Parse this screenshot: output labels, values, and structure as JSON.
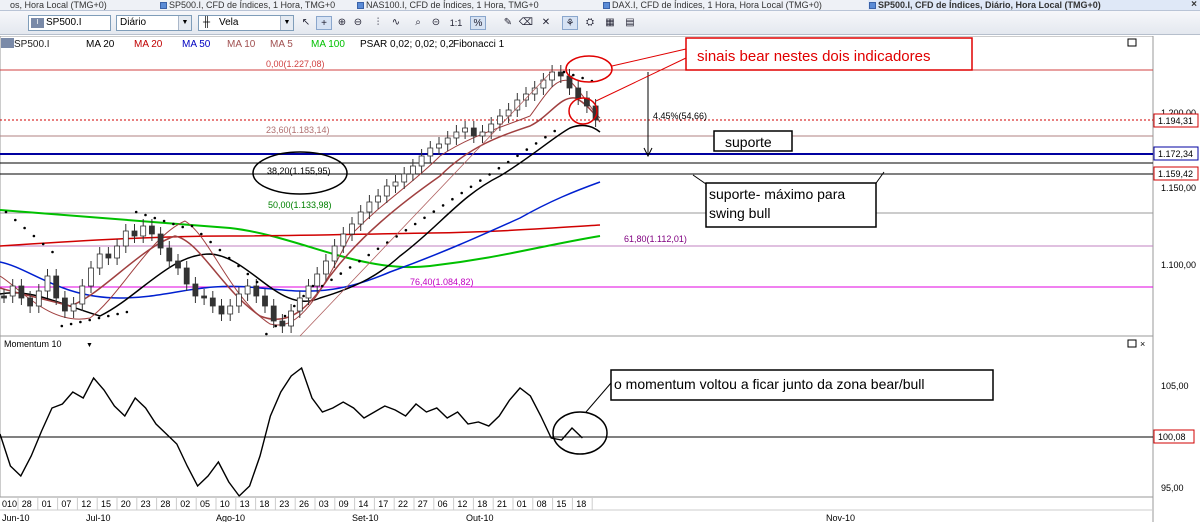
{
  "tabs": [
    {
      "label": "os, Hora Local (TMG+0)",
      "active": false
    },
    {
      "label": "SP500.I, CFD de Índices, 1 Hora, TMG+0",
      "active": false
    },
    {
      "label": "NAS100.I, CFD de Índices, 1 Hora, TMG+0",
      "active": false
    },
    {
      "label": "DAX.I, CFD de Índices, 1 Hora, Hora Local (TMG+0)",
      "active": false
    },
    {
      "label": "SP500.I, CFD de Índices, Diário, Hora Local (TMG+0)",
      "active": true
    }
  ],
  "toolbar": {
    "symbol": "SP500.I",
    "timeframe": "Diário",
    "chart_type": "Vela",
    "icons": [
      "symbol-icon",
      "cursor-icon",
      "crosshair-icon",
      "zoom-in-icon",
      "zoom-out-icon",
      "candlestick-icon",
      "line-chart-icon",
      "one-to-one-icon",
      "percent-icon",
      "draw-icon",
      "eraser-icon",
      "trash-icon",
      "indicators-icon",
      "objects-icon",
      "grid-icon",
      "template-icon"
    ],
    "ratio_label": "1:1",
    "percent_label": "%"
  },
  "legend": {
    "symbol": "SP500.I",
    "items": [
      {
        "label": "MA 20",
        "color": "#000000"
      },
      {
        "label": "MA 20",
        "color": "#c00000"
      },
      {
        "label": "MA 50",
        "color": "#0000c0"
      },
      {
        "label": "MA 10",
        "color": "#a05050"
      },
      {
        "label": "MA 5",
        "color": "#a05050"
      },
      {
        "label": "MA 100",
        "color": "#00c000"
      },
      {
        "label": "PSAR 0,02; 0,02; 0,2",
        "color": "#000000"
      },
      {
        "label": "Fibonacci 1",
        "color": "#000000"
      }
    ]
  },
  "price_axis": {
    "labels": [
      "1.200,00",
      "1.150,00",
      "1.100,00"
    ],
    "current_price": "1.194,31",
    "support_price": "1.172,34",
    "level_price": "1.159,42"
  },
  "fibonacci": [
    {
      "label": "0,00(1.227,08)",
      "color": "#d04040"
    },
    {
      "label": "23,60(1.183,14)",
      "color": "#b07070"
    },
    {
      "label": "38,20(1.155,95)",
      "color": "#000000"
    },
    {
      "label": "50,00(1.133,98)",
      "color": "#008000"
    },
    {
      "label": "61,80(1.112,01)",
      "color": "#800080"
    },
    {
      "label": "76,40(1.084,82)",
      "color": "#c000c0"
    }
  ],
  "measure_label": "4,45%(54,66)",
  "annotations": {
    "bear": "sinais bear nestes dois indicadores",
    "support": "suporte",
    "support_max": "suporte- máximo para swing bull",
    "momentum": "o momentum voltou a ficar junto da zona bear/bull"
  },
  "momentum_panel": {
    "title": "Momentum 10",
    "labels": [
      "105,00",
      "95,00"
    ],
    "current": "100,08"
  },
  "time_axis": {
    "days": [
      "010",
      "28",
      "01",
      "07",
      "12",
      "15",
      "20",
      "23",
      "28",
      "02",
      "05",
      "10",
      "13",
      "18",
      "23",
      "26",
      "03",
      "09",
      "14",
      "17",
      "22",
      "27",
      "06",
      "12",
      "18",
      "21",
      "01",
      "08",
      "15",
      "18"
    ],
    "months": [
      "Jun-10",
      "Jul-10",
      "Ago-10",
      "Set-10",
      "Out-10",
      "Nov-10"
    ]
  },
  "colors": {
    "support_line": "#0000a0",
    "current_line": "#d00000",
    "annotation_red": "#e00000",
    "ma20_red": "#d00000",
    "ma50_blue": "#0020d0",
    "ma100_green": "#00c000",
    "ma_black": "#000000",
    "ma_brown": "#a04040",
    "candle_up": "#00a000",
    "candle_down": "#c00000"
  }
}
